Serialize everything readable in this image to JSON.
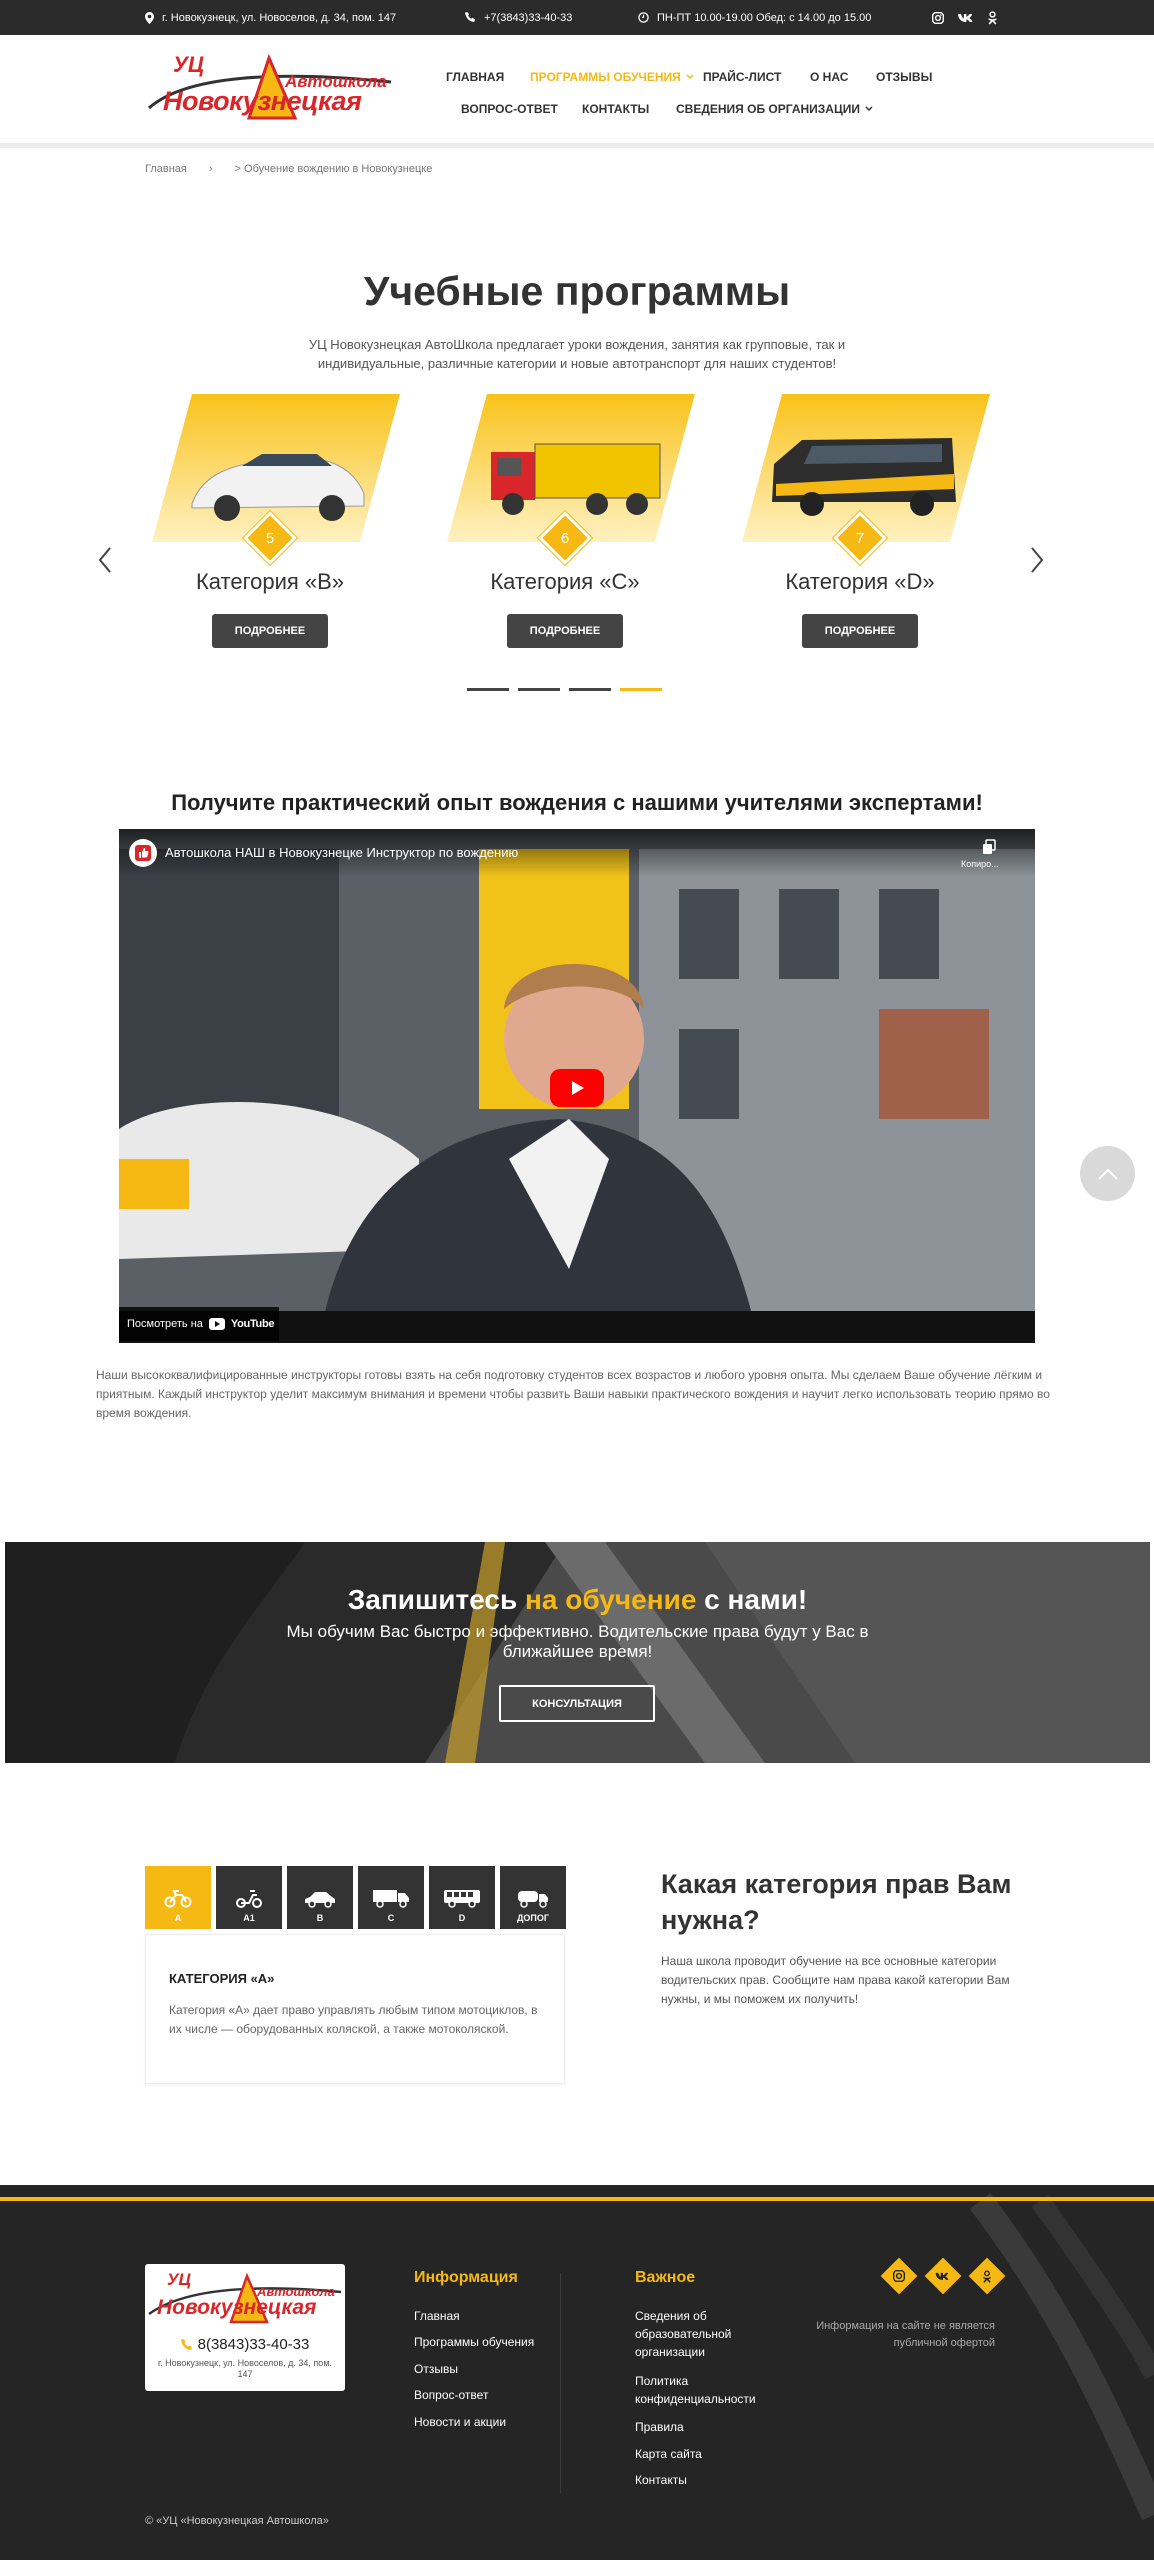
{
  "topbar": {
    "address": "г. Новокузнецк, ул. Новоселов, д. 34, пом. 147",
    "phone": "+7(3843)33-40-33",
    "hours": "ПН-ПТ 10.00-19.00 Обед: с 14.00 до 15.00",
    "social_icons": [
      "instagram-icon",
      "vk-icon",
      "odnoklassniki-icon"
    ]
  },
  "logo": {
    "abbr": "УЦ",
    "line1": "Автошкола",
    "line2": "Новокузнецкая"
  },
  "nav": {
    "row1": [
      "ГЛАВНАЯ",
      "ПРОГРАММЫ ОБУЧЕНИЯ",
      "ПРАЙС-ЛИСТ",
      "О НАС",
      "ОТЗЫВЫ"
    ],
    "row2": [
      "ВОПРОС-ОТВЕТ",
      "КОНТАКТЫ",
      "СВЕДЕНИЯ ОБ ОРГАНИЗАЦИИ"
    ],
    "active": "ПРОГРАММЫ ОБУЧЕНИЯ"
  },
  "breadcrumb": {
    "home": "Главная",
    "sep": "›",
    "current": "> Обучение вождению в Новокузнецке"
  },
  "programs": {
    "title": "Учебные программы",
    "intro": "УЦ Новокузнецкая АвтоШкола предлагает уроки вождения, занятия как групповые, так и индивидуальные, различные категории и новые автотранспорт для наших студентов!",
    "cards": [
      {
        "num": "5",
        "title": "Категория «B»",
        "button": "ПОДРОБНЕЕ"
      },
      {
        "num": "6",
        "title": "Категория «C»",
        "button": "ПОДРОБНЕЕ"
      },
      {
        "num": "7",
        "title": "Категория «D»",
        "button": "ПОДРОБНЕЕ"
      }
    ],
    "active_dot": 4
  },
  "video_section": {
    "title": "Получите практический опыт вождения с нашими учителями экспертами!",
    "video_title": "Автошкола НАШ в Новокузнецке Инструктор по вождению",
    "copy_label": "Копиро...",
    "watch_label": "Посмотреть на",
    "yt_label": "YouTube",
    "description": "Наши высококвалифицированные инструкторы готовы взять на себя подготовку студентов всех возрастов и любого уровня опыта. Мы сделаем Ваше обучение лёгким и приятным. Каждый инструктор уделит максимум внимания и времени чтобы развить Ваши навыки практического вождения и научит легко использовать теорию прямо во время вождения."
  },
  "banner": {
    "title_start": "Запишитесь ",
    "title_accent": "на обучение",
    "title_end": " с нами!",
    "subtitle": "Мы обучим Вас быстро и эффективно. Водительские права будут у Вас в ближайшее время!",
    "button": "КОНСУЛЬТАЦИЯ"
  },
  "categories": {
    "tabs": [
      {
        "label": "A",
        "icon": "motorcycle-icon"
      },
      {
        "label": "A1",
        "icon": "moped-icon"
      },
      {
        "label": "B",
        "icon": "car-icon"
      },
      {
        "label": "C",
        "icon": "truck-icon"
      },
      {
        "label": "D",
        "icon": "bus-icon"
      },
      {
        "label": "ДОПОГ",
        "icon": "tanker-icon"
      }
    ],
    "active_title": "КАТЕГОРИЯ «A»",
    "active_text": "Категория «A» дает право управлять любым типом мотоциклов, в их числе — оборудованных коляской, а также мотоколяской.",
    "question_title": "Какая категория прав Вам нужна?",
    "question_text": "Наша школа проводит обучение на все основные категории водительских прав. Сообщите нам права какой категории Вам нужны, и мы поможем их получить!"
  },
  "footer": {
    "phone": "8(3843)33-40-33",
    "address": "г. Новокузнецк, ул. Новоселов, д. 34, пом. 147",
    "info_title": "Информация",
    "info_links": [
      "Главная",
      "Программы обучения",
      "Отзывы",
      "Вопрос-ответ",
      "Новости и акции"
    ],
    "important_title": "Важное",
    "important_links": [
      "Сведения об образовательной организации",
      "Политика конфиденциальности",
      "Правила",
      "Карта сайта",
      "Контакты"
    ],
    "note": "Информация на сайте не является публичной офертой",
    "copyright": "© «УЦ «Новокузнецкая Автошкола»"
  },
  "colors": {
    "accent": "#f6b812",
    "dark": "#2b2b2b",
    "button": "#444444"
  }
}
